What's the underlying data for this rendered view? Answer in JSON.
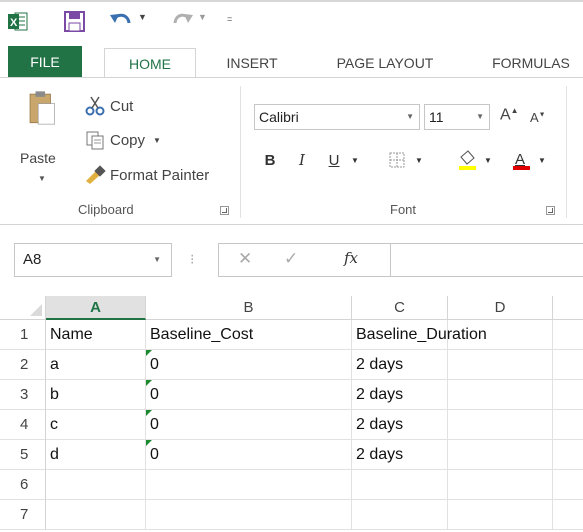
{
  "quick_access": {
    "app_icon": "excel-logo-icon",
    "save_icon": "save-icon",
    "undo_icon": "undo-icon",
    "redo_icon": "redo-icon"
  },
  "tabs": [
    {
      "label": "FILE"
    },
    {
      "label": "HOME"
    },
    {
      "label": "INSERT"
    },
    {
      "label": "PAGE LAYOUT"
    },
    {
      "label": "FORMULAS"
    }
  ],
  "ribbon": {
    "clipboard": {
      "paste_label": "Paste",
      "cut_label": "Cut",
      "copy_label": "Copy",
      "format_painter_label": "Format Painter",
      "group_label": "Clipboard"
    },
    "font": {
      "font_name": "Calibri",
      "font_size": "11",
      "bold": "B",
      "italic": "I",
      "underline": "U",
      "group_label": "Font"
    }
  },
  "formula_bar": {
    "name_box": "A8",
    "fx_label": "fx",
    "formula": ""
  },
  "sheet": {
    "columns": [
      "A",
      "B",
      "C",
      "D"
    ],
    "rows": [
      "1",
      "2",
      "3",
      "4",
      "5",
      "6",
      "7"
    ],
    "selected_column": "A",
    "cells": [
      [
        "Name",
        "Baseline_Cost",
        "Baseline_Duration",
        ""
      ],
      [
        "a",
        "0",
        "2 days",
        ""
      ],
      [
        "b",
        "0",
        "2 days",
        ""
      ],
      [
        "c",
        "0",
        "2 days",
        ""
      ],
      [
        "d",
        "0",
        "2 days",
        ""
      ],
      [
        "",
        "",
        "",
        ""
      ],
      [
        "",
        "",
        "",
        ""
      ]
    ],
    "error_indicator_color": "#1b8a2f"
  },
  "colors": {
    "accent": "#217346",
    "font_highlight": "#ffff00",
    "font_color": "#e00000"
  }
}
